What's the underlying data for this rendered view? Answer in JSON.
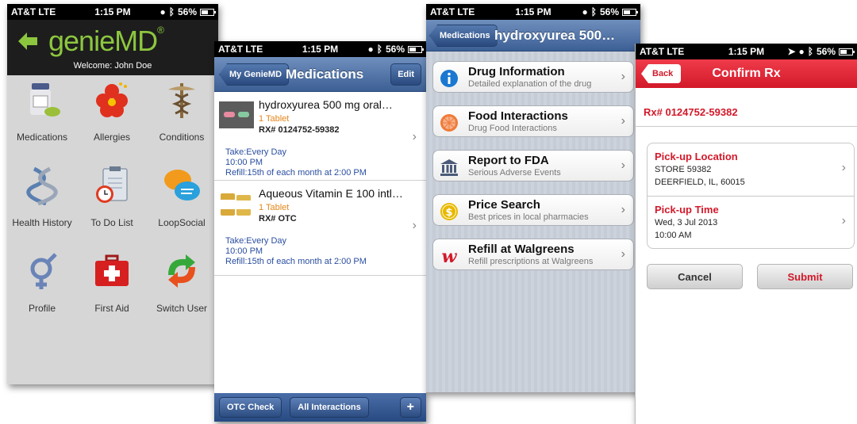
{
  "colors": {
    "genie_green": "#8cc63f",
    "ios_blue": "#3c5f95",
    "walgreens_red": "#d2192a",
    "schedule_blue": "#2a4ea0",
    "qty_orange": "#e6861a"
  },
  "status": {
    "carrier": "AT&T  LTE",
    "time": "1:15 PM",
    "battery": "56%"
  },
  "home": {
    "logo": "genieMD",
    "welcome": "Welcome: John Doe",
    "items": [
      {
        "label": "Medications",
        "icon": "pill-bottle-icon"
      },
      {
        "label": "Allergies",
        "icon": "flower-icon"
      },
      {
        "label": "Conditions",
        "icon": "caduceus-icon"
      },
      {
        "label": "Health History",
        "icon": "dna-icon"
      },
      {
        "label": "To Do List",
        "icon": "clipboard-clock-icon"
      },
      {
        "label": "LoopSocial",
        "icon": "chat-bubbles-icon"
      },
      {
        "label": "Profile",
        "icon": "gender-symbol-icon"
      },
      {
        "label": "First Aid",
        "icon": "first-aid-kit-icon"
      },
      {
        "label": "Switch User",
        "icon": "switch-arrows-icon"
      }
    ]
  },
  "medications": {
    "back": "My GenieMD",
    "title": "Medications",
    "edit": "Edit",
    "list": [
      {
        "name": "hydroxyurea 500 mg oral…",
        "qty": "1 Tablet",
        "rx": "RX# 0124752-59382",
        "take": "Take:Every Day",
        "time": "10:00 PM",
        "refill": "Refill:15th of each month at 2:00 PM"
      },
      {
        "name": "Aqueous Vitamin E 100 intl…",
        "qty": "1 Tablet",
        "rx": "RX# OTC",
        "take": "Take:Every Day",
        "time": "10:00 PM",
        "refill": "Refill:15th of each month at 2:00 PM"
      }
    ],
    "toolbar": {
      "otc": "OTC Check",
      "all": "All Interactions",
      "add": "+"
    }
  },
  "drug": {
    "back": "Medications",
    "title": "hydroxyurea 500…",
    "rows": [
      {
        "title": "Drug Information",
        "sub": "Detailed explanation of the drug",
        "icon": "info-icon"
      },
      {
        "title": "Food Interactions",
        "sub": "Drug Food Interactions",
        "icon": "grapefruit-icon"
      },
      {
        "title": "Report to FDA",
        "sub": "Serious Adverse Events",
        "icon": "government-building-icon"
      },
      {
        "title": "Price Search",
        "sub": "Best prices in local pharmacies",
        "icon": "dollar-coin-icon"
      },
      {
        "title": "Refill at Walgreens",
        "sub": "Refill prescriptions at Walgreens",
        "icon": "walgreens-w-icon"
      }
    ]
  },
  "confirm": {
    "back": "Back",
    "title": "Confirm Rx",
    "rx": "Rx# 0124752-59382",
    "location": {
      "heading": "Pick-up Location",
      "line1": "STORE 59382",
      "line2": "DEERFIELD, IL, 60015"
    },
    "time": {
      "heading": "Pick-up Time",
      "line1": "Wed, 3 Jul 2013",
      "line2": "10:00 AM"
    },
    "cancel": "Cancel",
    "submit": "Submit"
  }
}
